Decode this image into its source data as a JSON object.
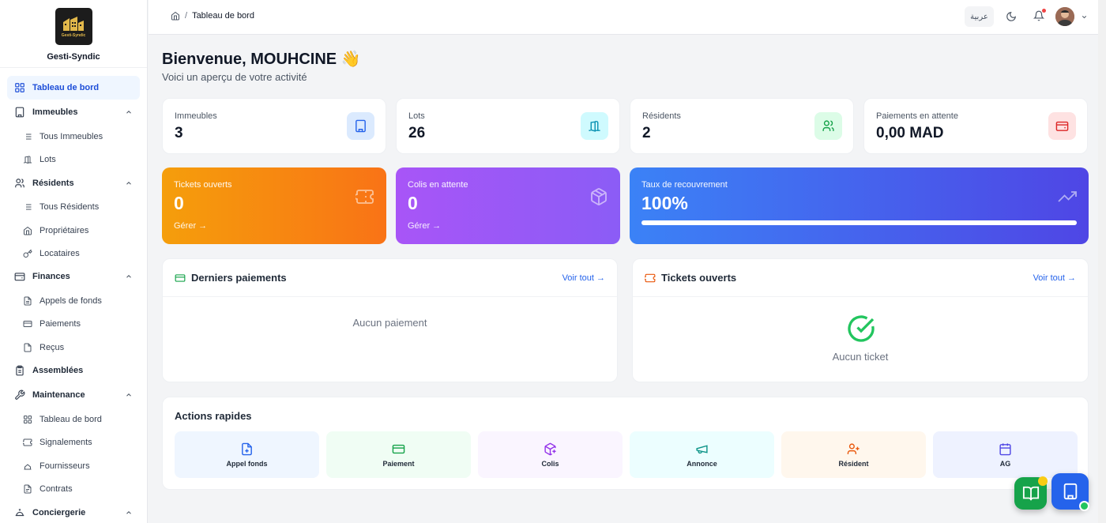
{
  "brand": {
    "name": "Gesti-Syndic",
    "logo_text": "Gesti-Syndic"
  },
  "header": {
    "breadcrumb": "Tableau de bord",
    "breadcrumb_sep": "/",
    "lang_button": "عربية"
  },
  "sidebar": {
    "dashboard": "Tableau de bord",
    "immeubles": {
      "label": "Immeubles",
      "items": [
        "Tous Immeubles",
        "Lots"
      ]
    },
    "residents": {
      "label": "Résidents",
      "items": [
        "Tous Résidents",
        "Propriétaires",
        "Locataires"
      ]
    },
    "finances": {
      "label": "Finances",
      "items": [
        "Appels de fonds",
        "Paiements",
        "Reçus"
      ]
    },
    "assemblees": "Assemblées",
    "maintenance": {
      "label": "Maintenance",
      "items": [
        "Tableau de bord",
        "Signalements",
        "Fournisseurs",
        "Contrats"
      ]
    },
    "conciergerie": "Conciergerie"
  },
  "main": {
    "welcome": "Bienvenue, MOUHCINE 👋",
    "subtitle": "Voici un aperçu de votre activité",
    "stats": [
      {
        "label": "Immeubles",
        "value": "3",
        "icon": "building-icon",
        "color": "#2563eb"
      },
      {
        "label": "Lots",
        "value": "26",
        "icon": "door-icon",
        "color": "#0891b2"
      },
      {
        "label": "Résidents",
        "value": "2",
        "icon": "users-icon",
        "color": "#16a34a"
      },
      {
        "label": "Paiements en attente",
        "value": "0,00 MAD",
        "icon": "wallet-icon",
        "color": "#dc2626"
      }
    ],
    "cards": {
      "tickets": {
        "label": "Tickets ouverts",
        "value": "0",
        "link": "Gérer →"
      },
      "colis": {
        "label": "Colis en attente",
        "value": "0",
        "link": "Gérer →"
      },
      "recouvrement": {
        "label": "Taux de recouvrement",
        "value": "100%",
        "progress": 1.0
      }
    },
    "panels": {
      "payments": {
        "title": "Derniers paiements",
        "link": "Voir tout →",
        "empty": "Aucun paiement"
      },
      "tickets": {
        "title": "Tickets ouverts",
        "link": "Voir tout →",
        "empty": "Aucun ticket"
      }
    },
    "quick_actions": {
      "title": "Actions rapides",
      "items": [
        {
          "label": "Appel fonds",
          "icon": "file-plus-icon",
          "color": "#2563eb",
          "bg": "#eff6ff"
        },
        {
          "label": "Paiement",
          "icon": "card-icon",
          "color": "#16a34a",
          "bg": "#f0fdf4"
        },
        {
          "label": "Colis",
          "icon": "package-icon",
          "color": "#9333ea",
          "bg": "#faf5ff"
        },
        {
          "label": "Annonce",
          "icon": "megaphone-icon",
          "color": "#0d9488",
          "bg": "#ecfeff"
        },
        {
          "label": "Résident",
          "icon": "user-plus-icon",
          "color": "#ea580c",
          "bg": "#fff7ed"
        },
        {
          "label": "AG",
          "icon": "calendar-icon",
          "color": "#4f46e5",
          "bg": "#eef2ff"
        }
      ]
    }
  }
}
